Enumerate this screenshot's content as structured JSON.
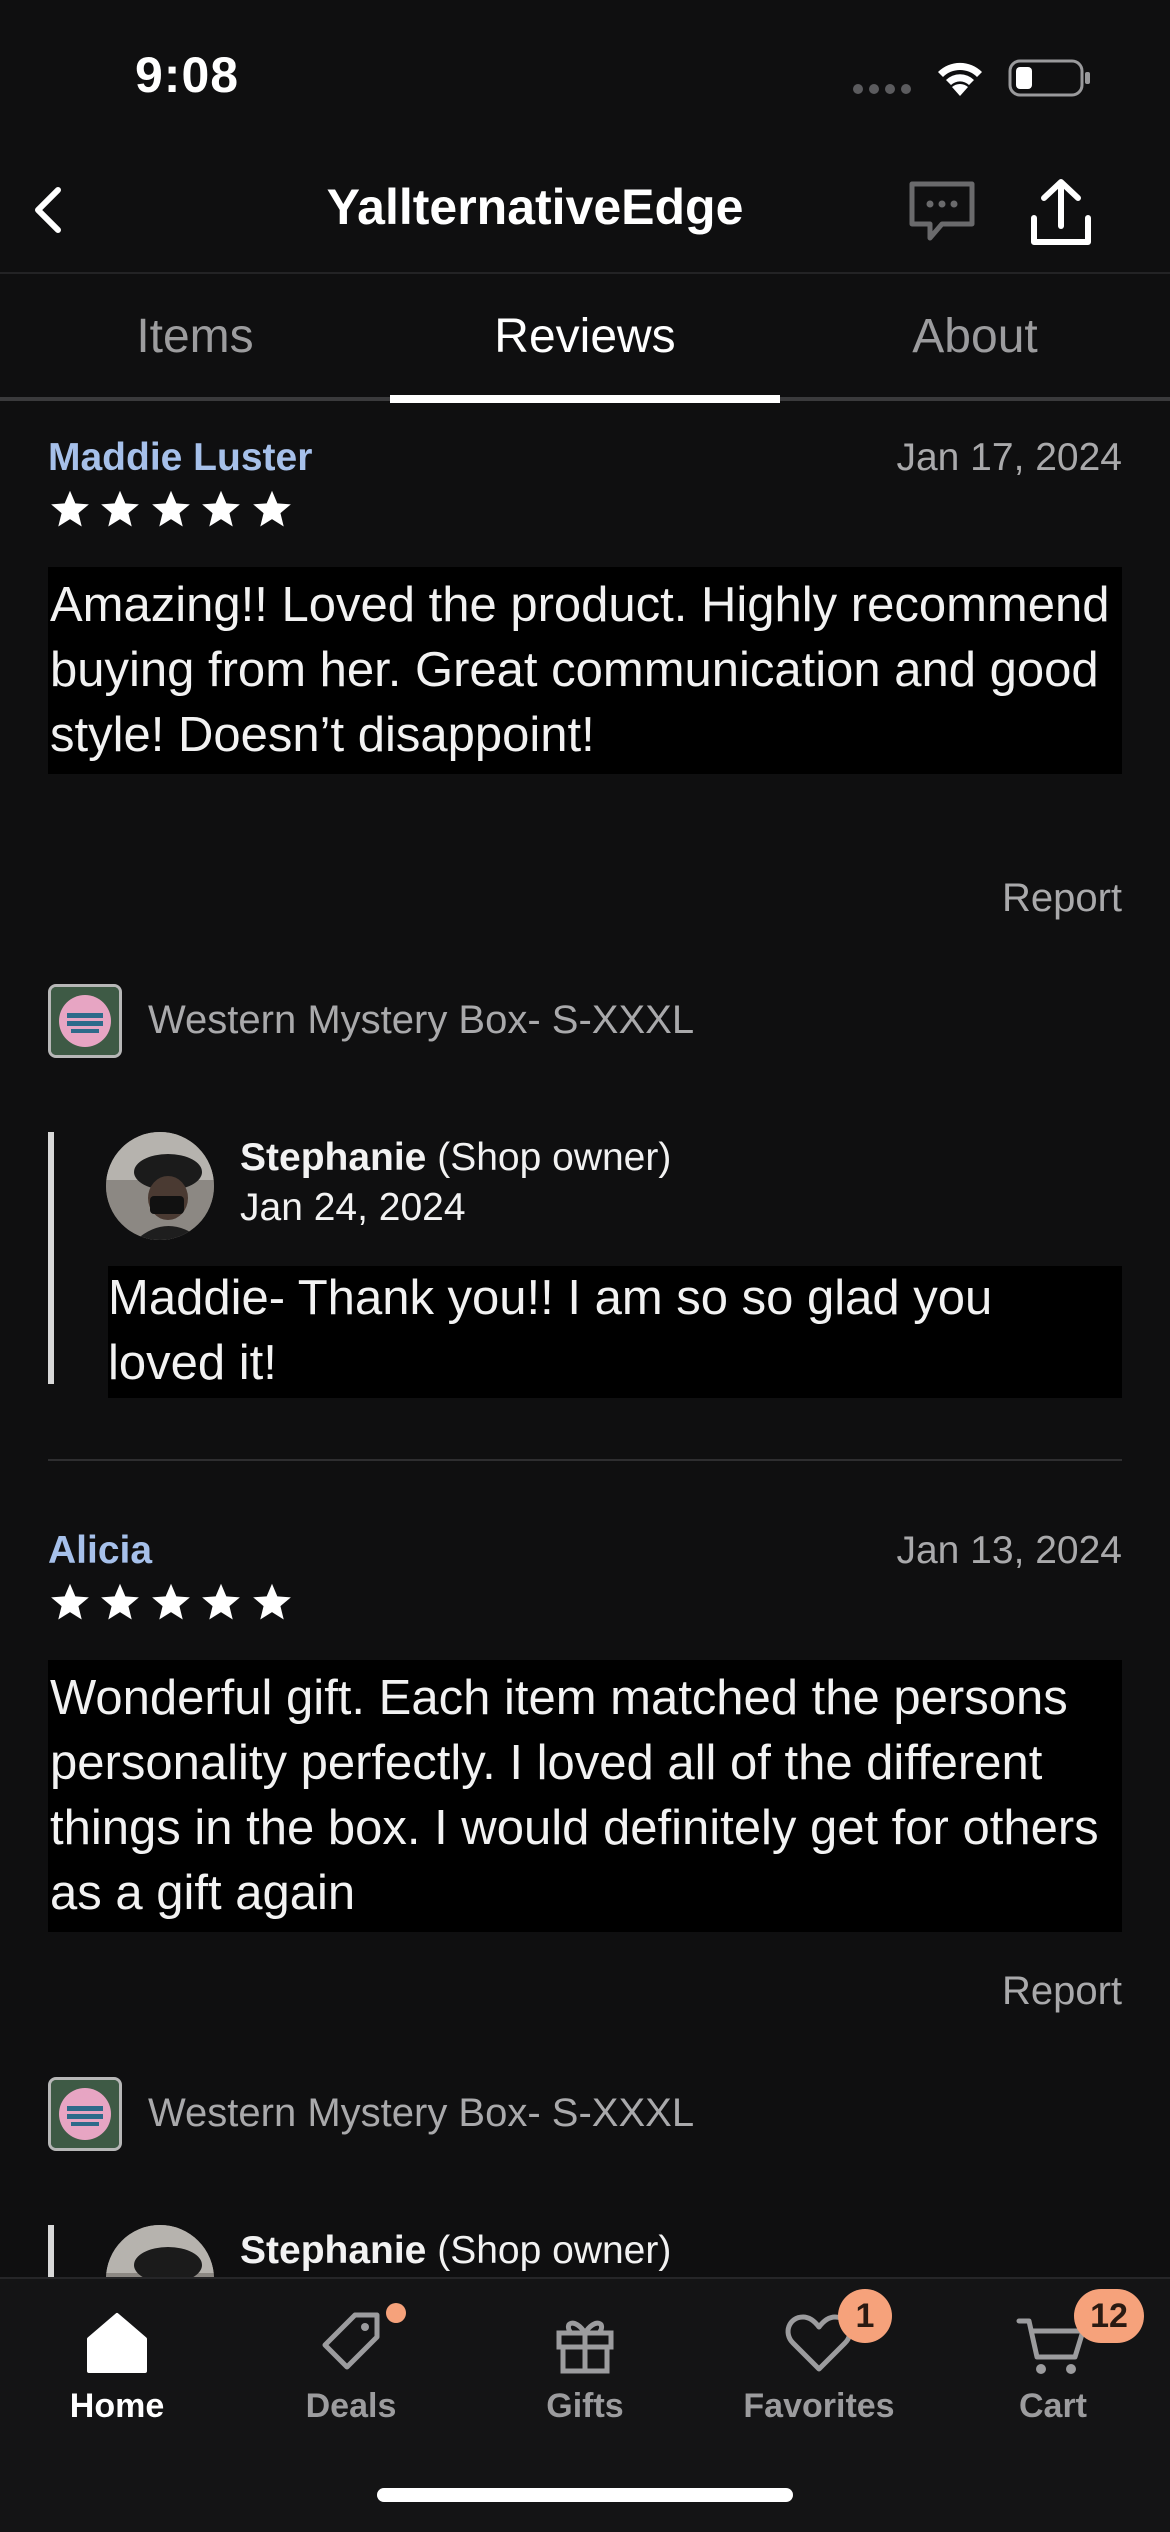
{
  "status_bar": {
    "time": "9:08"
  },
  "header": {
    "shop_name": "YallternativeEdge"
  },
  "tabs": [
    {
      "label": "Items",
      "active": false
    },
    {
      "label": "Reviews",
      "active": true
    },
    {
      "label": "About",
      "active": false
    }
  ],
  "reviews": [
    {
      "reviewer": "Maddie Luster",
      "date": "Jan 17, 2024",
      "rating": 5,
      "text": "Amazing!! Loved the product. Highly recommend buying from her. Great communication and good style! Doesn’t disappoint!",
      "report_label": "Report",
      "product": "Western Mystery Box- S-XXXL",
      "reply": {
        "name": "Stephanie",
        "role": "(Shop owner)",
        "date": "Jan 24, 2024",
        "text": "Maddie- Thank you!!  I am so so glad you loved it!"
      }
    },
    {
      "reviewer": "Alicia",
      "date": "Jan 13, 2024",
      "rating": 5,
      "text": "Wonderful gift. Each item matched the persons personality perfectly. I loved all of the different things in the box. I would definitely get for others as a gift again",
      "report_label": "Report",
      "product": "Western Mystery Box- S-XXXL",
      "reply": {
        "name": "Stephanie",
        "role": "(Shop owner)"
      }
    }
  ],
  "bottom_nav": [
    {
      "label": "Home",
      "icon": "home-icon",
      "active": true
    },
    {
      "label": "Deals",
      "icon": "tag-icon",
      "active": false,
      "dot": true
    },
    {
      "label": "Gifts",
      "icon": "gift-icon",
      "active": false
    },
    {
      "label": "Favorites",
      "icon": "heart-icon",
      "active": false,
      "badge": "1"
    },
    {
      "label": "Cart",
      "icon": "cart-icon",
      "active": false,
      "badge": "12"
    }
  ],
  "colors": {
    "background": "#0f0f10",
    "reviewer_name": "#a6c0ea",
    "badge": "#f6a27b",
    "muted_text": "#a9a9ab"
  }
}
